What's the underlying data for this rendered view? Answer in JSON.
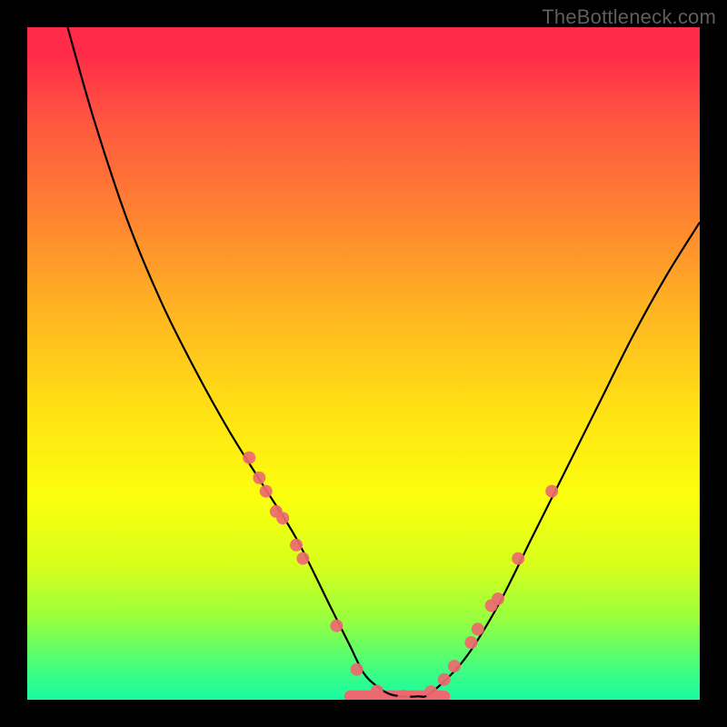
{
  "watermark": "TheBottleneck.com",
  "chart_data": {
    "type": "line",
    "title": "",
    "xlabel": "",
    "ylabel": "",
    "xlim": [
      0,
      100
    ],
    "ylim": [
      0,
      100
    ],
    "grid": false,
    "series": [
      {
        "name": "curve",
        "style": "black-line",
        "x": [
          6,
          10,
          15,
          20,
          25,
          30,
          35,
          40,
          45,
          46,
          48,
          50,
          52,
          54,
          56,
          58,
          60,
          65,
          70,
          75,
          80,
          85,
          90,
          95,
          100
        ],
        "y": [
          100,
          86,
          71,
          59,
          49,
          40,
          32,
          24,
          14,
          12,
          8,
          4,
          2,
          0.8,
          0.5,
          0.5,
          1,
          6,
          14,
          24,
          34,
          44,
          54,
          63,
          71
        ]
      }
    ],
    "markers": [
      {
        "x": 33,
        "y": 36
      },
      {
        "x": 34.5,
        "y": 33
      },
      {
        "x": 35.5,
        "y": 31
      },
      {
        "x": 37,
        "y": 28
      },
      {
        "x": 38,
        "y": 27
      },
      {
        "x": 40,
        "y": 23
      },
      {
        "x": 41,
        "y": 21
      },
      {
        "x": 46,
        "y": 11
      },
      {
        "x": 49,
        "y": 4.5
      },
      {
        "x": 52,
        "y": 1.3
      },
      {
        "x": 56,
        "y": 0.5
      },
      {
        "x": 60,
        "y": 1.2
      },
      {
        "x": 62,
        "y": 3
      },
      {
        "x": 63.5,
        "y": 5
      },
      {
        "x": 66,
        "y": 8.5
      },
      {
        "x": 67,
        "y": 10.5
      },
      {
        "x": 69,
        "y": 14
      },
      {
        "x": 70,
        "y": 15
      },
      {
        "x": 73,
        "y": 21
      },
      {
        "x": 78,
        "y": 31
      }
    ],
    "marker_color": "#ec6a6f",
    "marker_radius_px": 7,
    "baseline_segment": {
      "x1": 48,
      "x2": 62,
      "y": 0.5,
      "stroke_px": 13,
      "color": "#ec6a6f"
    },
    "curve_stroke_px": 2.2
  }
}
